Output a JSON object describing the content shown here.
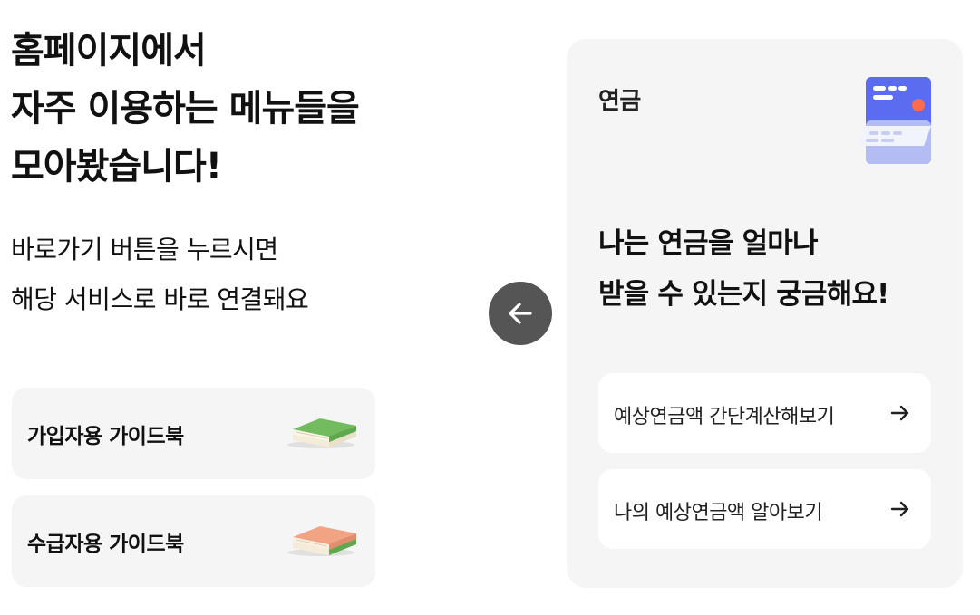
{
  "intro": {
    "title_lines": [
      "홈페이지에서",
      "자주 이용하는 메뉴들을",
      "모아봤습니다!"
    ],
    "description_lines": [
      "바로가기 버튼을 누르시면",
      "해당 서비스로 바로 연결돼요"
    ]
  },
  "guides": [
    {
      "label": "가입자용 가이드북",
      "icon": "green-book-icon"
    },
    {
      "label": "수급자용 가이드북",
      "icon": "orange-book-icon"
    }
  ],
  "carousel": {
    "prev_icon": "arrow-left-icon"
  },
  "panel": {
    "title": "연금",
    "icon": "pension-card-icon",
    "headline_lines": [
      "나는 연금을 얼마나",
      "받을 수 있는지 궁금해요!"
    ],
    "links": [
      {
        "label": "예상연금액 간단계산해보기",
        "icon": "arrow-right-icon"
      },
      {
        "label": "나의 예상연금액 알아보기",
        "icon": "arrow-right-icon"
      }
    ]
  },
  "colors": {
    "card_bg": "#f5f5f5",
    "nav_button": "#555555",
    "card_icon_blue": "#5b6cf0",
    "card_icon_dot": "#ff6b4a",
    "book_green": "#6bb35a",
    "book_orange": "#f0a080"
  }
}
